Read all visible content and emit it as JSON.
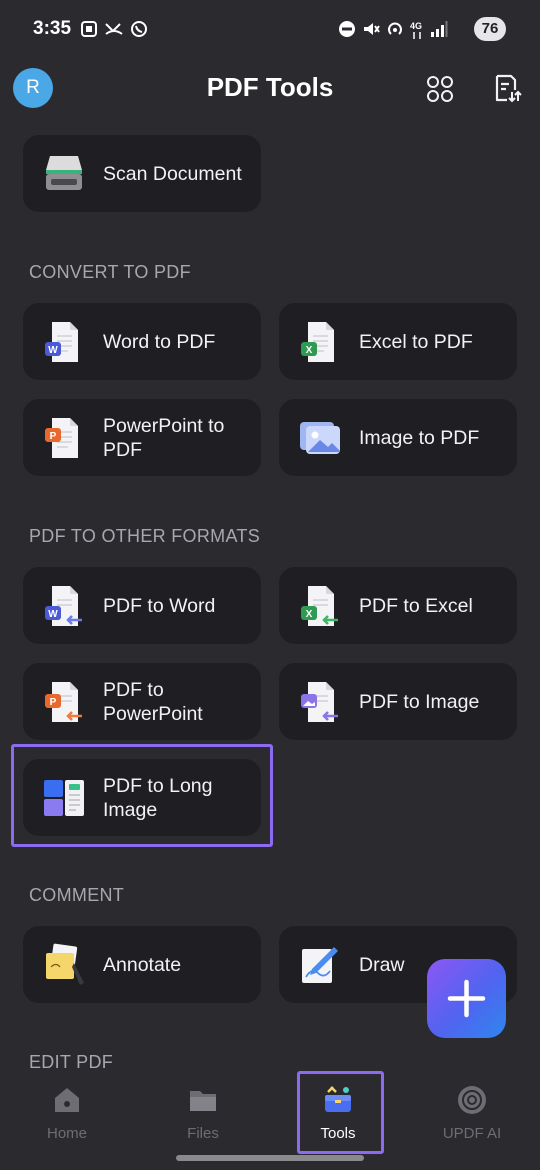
{
  "status_bar": {
    "time": "3:35",
    "battery": "76"
  },
  "app_bar": {
    "avatar_letter": "R",
    "title": "PDF Tools"
  },
  "cards": {
    "scan_document": "Scan Document",
    "word_to_pdf": "Word to PDF",
    "excel_to_pdf": "Excel to PDF",
    "powerpoint_to_pdf": "PowerPoint to PDF",
    "image_to_pdf": "Image to PDF",
    "pdf_to_word": "PDF to Word",
    "pdf_to_excel": "PDF to Excel",
    "pdf_to_powerpoint": "PDF to PowerPoint",
    "pdf_to_image": "PDF to Image",
    "pdf_to_long_image": "PDF to Long Image",
    "annotate": "Annotate",
    "draw": "Draw"
  },
  "sections": {
    "convert_to_pdf": "CONVERT TO PDF",
    "pdf_to_other_formats": "PDF TO OTHER FORMATS",
    "comment": "COMMENT",
    "edit_pdf": "EDIT PDF"
  },
  "bottom_nav": {
    "items": [
      {
        "label": "Home"
      },
      {
        "label": "Files"
      },
      {
        "label": "Tools"
      },
      {
        "label": "UPDF AI"
      }
    ],
    "active": "Tools"
  },
  "colors": {
    "background": "#2b2a2f",
    "card": "#1f1e22",
    "highlight": "#8b6cf0",
    "fab_gradient_start": "#8c57f2",
    "fab_gradient_end": "#2f86ee",
    "avatar": "#4aa8e6",
    "word": "#4b5bd6",
    "excel": "#2e9a52",
    "powerpoint": "#e8692e"
  },
  "icons": {
    "status_left": [
      "screenshot-icon",
      "missed-call-icon",
      "whatsapp-icon"
    ],
    "status_right": [
      "do-not-disturb-icon",
      "mute-icon",
      "hotspot-icon",
      "4g-data-icon",
      "signal-icon",
      "battery-icon"
    ],
    "app_bar": [
      "apps-grid-icon",
      "sort-document-icon"
    ],
    "fab": "plus-icon"
  }
}
